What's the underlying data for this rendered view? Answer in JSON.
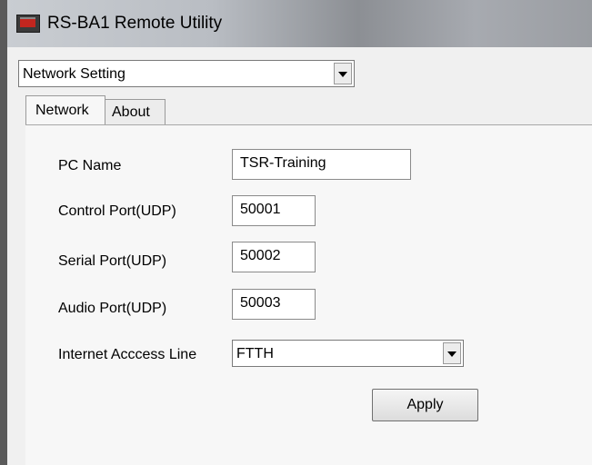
{
  "window": {
    "title": "RS-BA1 Remote Utility"
  },
  "mode_select": {
    "value": "Network Setting"
  },
  "tabs": [
    {
      "label": "Network",
      "active": true
    },
    {
      "label": "About",
      "active": false
    }
  ],
  "form": {
    "pc_name": {
      "label": "PC Name",
      "value": "TSR-Training"
    },
    "control_port": {
      "label": "Control Port(UDP)",
      "value": "50001"
    },
    "serial_port": {
      "label": "Serial Port(UDP)",
      "value": "50002"
    },
    "audio_port": {
      "label": "Audio Port(UDP)",
      "value": "50003"
    },
    "internet_access_line": {
      "label": "Internet Acccess Line",
      "value": "FTTH"
    }
  },
  "buttons": {
    "apply": "Apply"
  },
  "icons": {
    "app": "rs-ba1-app-icon",
    "dropdown": "chevron-down-icon"
  }
}
